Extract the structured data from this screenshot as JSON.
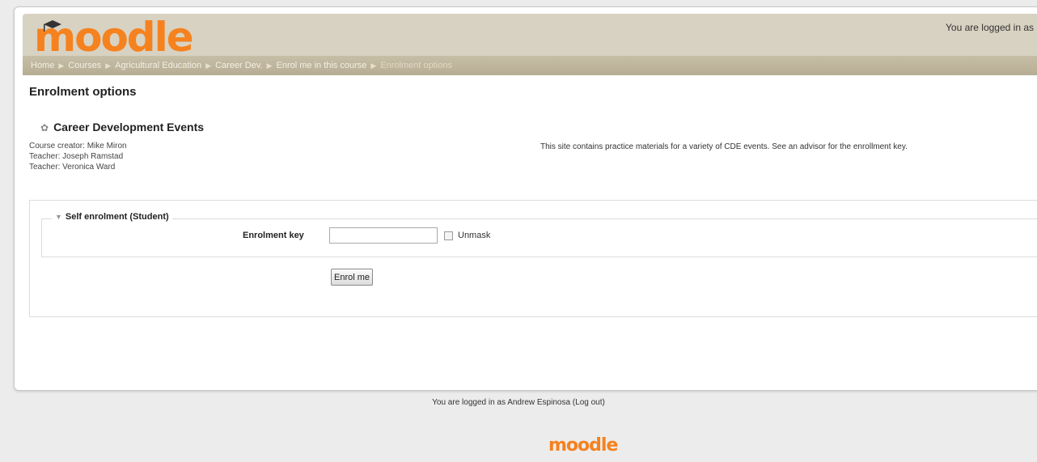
{
  "header": {
    "logo_text": "moodle",
    "login_status": "You are logged in as"
  },
  "breadcrumb": [
    "Home",
    "Courses",
    "Agricultural Education",
    "Career Dev.",
    "Enrol me in this course",
    "Enrolment options"
  ],
  "page": {
    "heading": "Enrolment options",
    "course_title": "Career Development Events",
    "contacts": [
      "Course creator: Mike Miron",
      "Teacher: Joseph Ramstad",
      "Teacher: Veronica Ward"
    ],
    "summary": "This site contains practice materials for a variety of CDE events. See an advisor for the enrollment key."
  },
  "enrol": {
    "legend": "Self enrolment (Student)",
    "key_label": "Enrolment key",
    "key_value": "",
    "unmask_label": "Unmask",
    "button_label": "Enrol me"
  },
  "footer": {
    "login_text": "You are logged in as Andrew Espinosa (Log out)",
    "logo_text": "moodle"
  },
  "colors": {
    "brand": "#f5821f",
    "header_bg": "#d8d2c2",
    "navbar_bg": "#b7ad94"
  }
}
